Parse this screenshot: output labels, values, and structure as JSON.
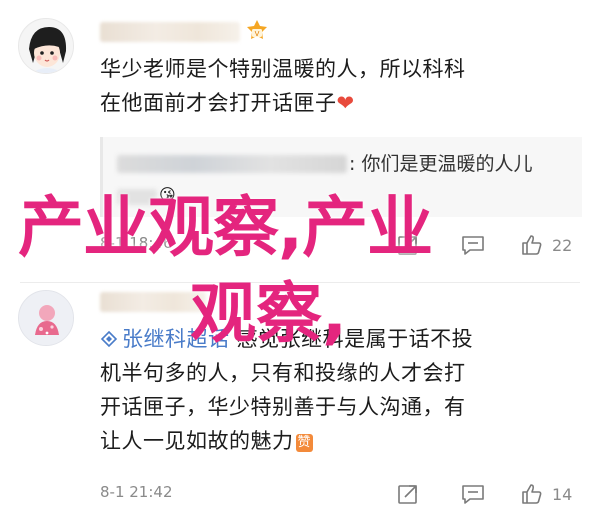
{
  "comments": [
    {
      "text_line1": "华少老师是个特别温暖的人，所以科科",
      "text_line2": "在他面前才会打开话匣子",
      "heart": "❤",
      "quote": {
        "text": ": 你们是更温暖的人儿",
        "emoji": "😘"
      },
      "time": "8-1 18:46",
      "like_count": "22",
      "icons": [
        "share-icon",
        "comment-icon",
        "like-icon"
      ]
    },
    {
      "mention": "张继科超话",
      "text_line1_rest": " 感觉张继科是属于话不投",
      "text_line2": "机半句多的人，只有和投缘的人才会打",
      "text_line3": "开话匣子，华少特别善于与人沟通，有",
      "text_line4": "让人一见如故的魅力",
      "zan": "赞",
      "time": "8-1 21:42",
      "like_count": "14",
      "icons": [
        "share-icon",
        "comment-icon",
        "like-icon"
      ]
    }
  ],
  "overlay": {
    "line1": "产业观察,产业",
    "line2": "观察,"
  },
  "colors": {
    "overlay": "#e4257e",
    "mention": "#4a7cc9",
    "meta": "#8a8a8a",
    "heart": "#e84a3c"
  }
}
